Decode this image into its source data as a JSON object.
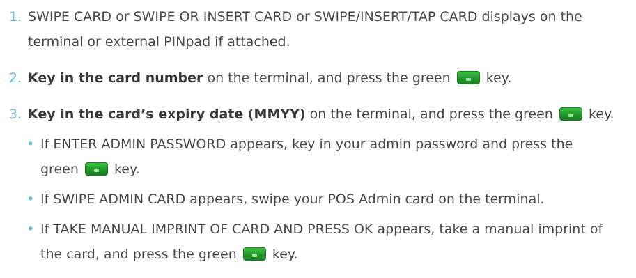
{
  "steps": [
    {
      "num": "1.",
      "text": "SWIPE CARD or SWIPE OR INSERT CARD or SWIPE/INSERT/TAP CARD displays on the terminal or external PINpad if attached."
    },
    {
      "num": "2.",
      "bold": "Key in the card number",
      "text_before_key": " on the terminal, and press the green ",
      "text_after_key": " key."
    },
    {
      "num": "3.",
      "bold": "Key in the card’s expiry date (MMYY)",
      "text_before_key": " on the terminal, and press the green ",
      "text_after_key": " key.",
      "bullets": [
        {
          "bullet": "•",
          "text_before_key": "If ENTER ADMIN PASSWORD appears, key in your admin password and press the green ",
          "text_after_key": " key."
        },
        {
          "bullet": "•",
          "text": "If SWIPE ADMIN CARD appears, swipe your POS Admin card on the terminal."
        },
        {
          "bullet": "•",
          "text_before_key": "If TAKE MANUAL IMPRINT OF CARD AND PRESS OK appears, take a manual imprint of the card, and press the green ",
          "text_after_key": " key."
        }
      ]
    }
  ],
  "icons": {
    "green_key": "green-enter-key-icon"
  },
  "colors": {
    "step_number": "#6bb6d6",
    "body_text": "#4a4a4a",
    "green_key": "#22972a"
  }
}
